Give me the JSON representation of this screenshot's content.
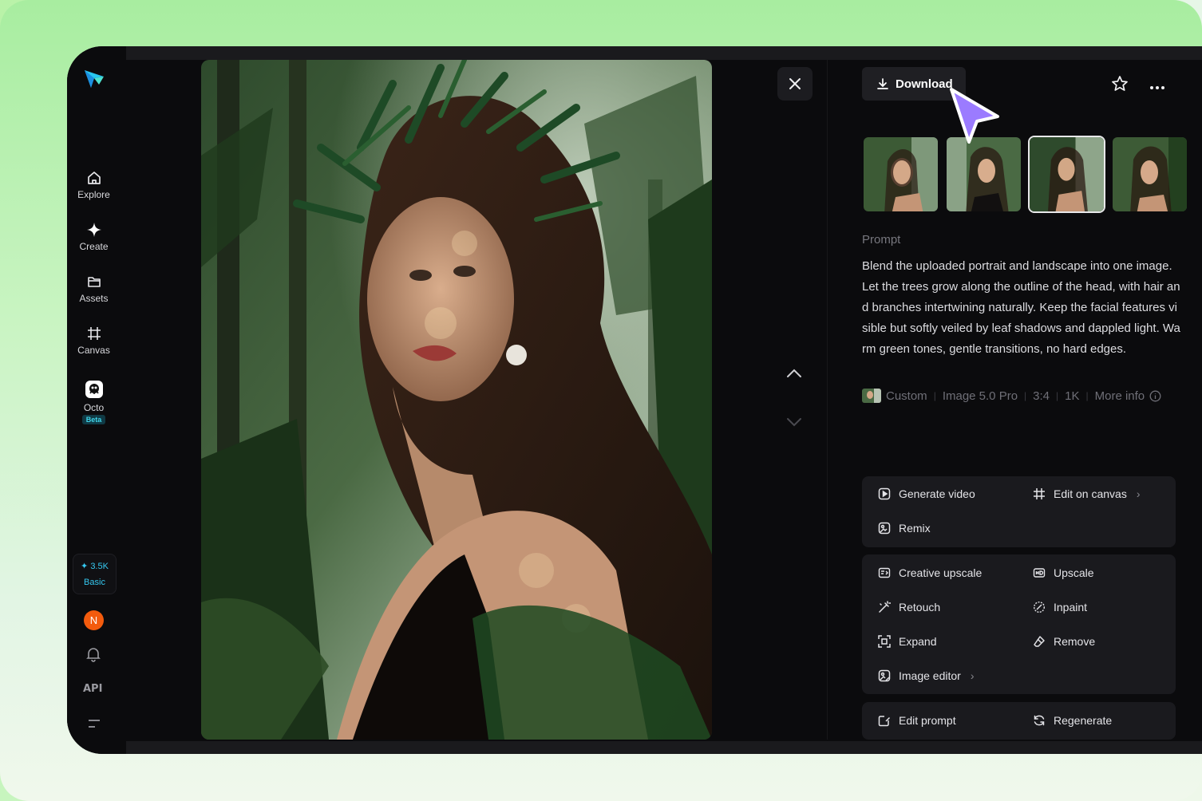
{
  "sidebar": {
    "items": [
      {
        "label": "Explore",
        "icon": "home-icon"
      },
      {
        "label": "Create",
        "icon": "sparkle-icon"
      },
      {
        "label": "Assets",
        "icon": "folder-icon"
      },
      {
        "label": "Canvas",
        "icon": "canvas-icon"
      },
      {
        "label": "Octo",
        "icon": "octo-icon",
        "badge": "Beta"
      }
    ],
    "credits": {
      "amount": "3.5K",
      "plan": "Basic"
    },
    "avatar_initial": "N",
    "api_label": "API"
  },
  "toolbar": {
    "download_label": "Download"
  },
  "prompt": {
    "label": "Prompt",
    "text": "Blend the uploaded portrait and landscape into one image. Let the trees grow along the outline of the head, with hair and branches intertwining naturally. Keep the facial features visible but softly veiled by leaf shadows and dappled light. Warm green tones, gentle transitions, no hard edges."
  },
  "meta": {
    "style": "Custom",
    "model": "Image 5.0 Pro",
    "ratio": "3:4",
    "resolution": "1K",
    "more_info": "More info"
  },
  "actions": {
    "generate_video": "Generate video",
    "edit_on_canvas": "Edit on canvas",
    "remix": "Remix",
    "creative_upscale": "Creative upscale",
    "upscale": "Upscale",
    "retouch": "Retouch",
    "inpaint": "Inpaint",
    "expand": "Expand",
    "remove": "Remove",
    "image_editor": "Image editor",
    "edit_prompt": "Edit prompt",
    "regenerate": "Regenerate"
  },
  "thumbnails": {
    "count": 4,
    "selected_index": 2
  },
  "colors": {
    "background": "#0b0b0d",
    "panel": "#1a1a1e",
    "accent": "#35c8f0",
    "cursor": "#9b7bff",
    "avatar": "#f35b0d"
  }
}
